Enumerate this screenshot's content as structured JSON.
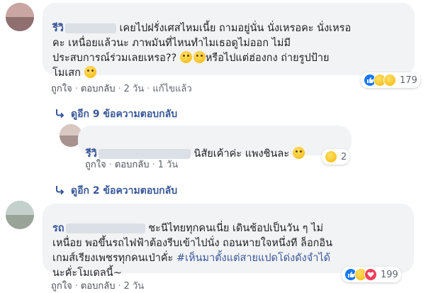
{
  "comments": [
    {
      "name": "รีวิ",
      "text_lines": [
        "เคยไปฝรั่งเศสไหมเนี้ย ถามอยู่นั่น นั่งเหรอคะ นั่งเหรอ",
        "คะ เหนื่อยแล้วนะ ภาพมันที่ไหนทำไมเธอดูไม่ออก ไม่มี",
        "ประสบการณ์ร่วมเลยเหรอ?? ",
        "หรือไปแต่ฮ่องกง ถ่ายรูปป้าย",
        "โมเสก "
      ],
      "actions": {
        "like": "ถูกใจ",
        "reply": "ตอบกลับ",
        "time": "2 วัน",
        "edited": "แก้ไขแล้ว"
      },
      "reactions": {
        "count": "179",
        "icons": [
          "like-icon",
          "haha-icon",
          "sad-icon"
        ]
      }
    },
    {
      "name": "รีวิ",
      "text": "นิสัยเค้าค่ะ แพงชินละ",
      "actions": {
        "like": "ถูกใจ",
        "reply": "ตอบกลับ",
        "time": "1 วัน"
      },
      "reactions": {
        "count": "2",
        "icons": [
          "haha-icon"
        ]
      }
    },
    {
      "name": "รถ",
      "text_lines": [
        "ชะนีไทยทุกคนเนี่ย เดินช้อปเป็นวัน ๆ ไม่",
        "เหนื่อย พอขึ้นรถไฟฟ้าต้องรีบเข้าไปนั่ง ถอนหายใจหนึ่งที ล็อกอิน",
        "เกมส์เรียงเพชรทุกคนเป่าคั่ะ "
      ],
      "hashtag": "#เห็นมาตั้งแต่สายแปดโด่งดังจำได้",
      "last_line": "นะคั่ะโมเดลนี้~",
      "actions": {
        "like": "ถูกใจ",
        "reply": "ตอบกลับ",
        "time": "2 วัน"
      },
      "reactions": {
        "count": "199",
        "icons": [
          "like-icon",
          "haha-icon",
          "love-icon"
        ]
      }
    }
  ],
  "replies_more": [
    {
      "label": "ดูอีก 9 ข้อความตอบกลับ"
    },
    {
      "label": "ดูอีก 2 ข้อความตอบกลับ"
    }
  ],
  "colors": {
    "link": "#385898",
    "bubble": "#f2f3f5",
    "like": "#1877f2",
    "love": "#f33e58"
  }
}
